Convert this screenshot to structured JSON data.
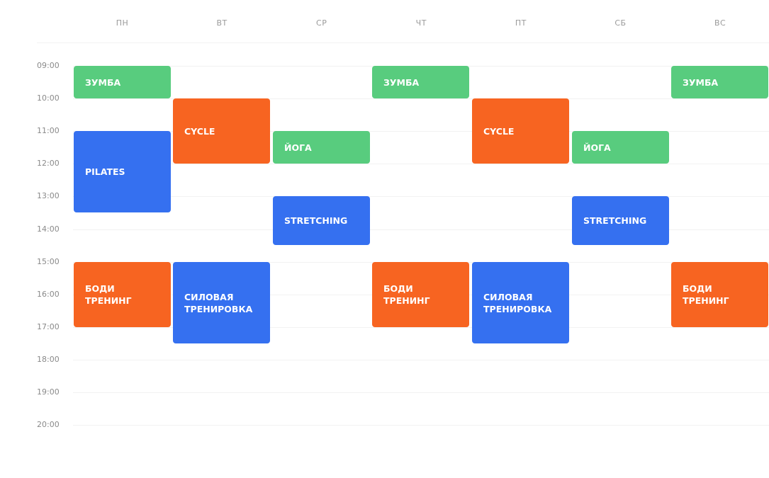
{
  "schedule": {
    "days": [
      "ПН",
      "ВТ",
      "СР",
      "ЧТ",
      "ПТ",
      "СБ",
      "ВС"
    ],
    "hours": [
      "09:00",
      "10:00",
      "11:00",
      "12:00",
      "13:00",
      "14:00",
      "15:00",
      "16:00",
      "17:00",
      "18:00",
      "19:00",
      "20:00"
    ],
    "colors": {
      "green": "#58cc7e",
      "orange": "#f76421",
      "blue": "#3570f0"
    },
    "events": [
      {
        "day": 0,
        "title": "ЗУМБА",
        "start": 9,
        "end": 10,
        "color": "green"
      },
      {
        "day": 0,
        "title": "PILATES",
        "start": 11,
        "end": 13.5,
        "color": "blue"
      },
      {
        "day": 0,
        "title": "БОДИ ТРЕНИНГ",
        "start": 15,
        "end": 17,
        "color": "orange"
      },
      {
        "day": 1,
        "title": "CYCLE",
        "start": 10,
        "end": 12,
        "color": "orange"
      },
      {
        "day": 1,
        "title": "СИЛОВАЯ ТРЕНИРОВКА",
        "start": 15,
        "end": 17.5,
        "color": "blue"
      },
      {
        "day": 2,
        "title": "ЙОГА",
        "start": 11,
        "end": 12,
        "color": "green"
      },
      {
        "day": 2,
        "title": "STRETCHING",
        "start": 13,
        "end": 14.5,
        "color": "blue"
      },
      {
        "day": 3,
        "title": "ЗУМБА",
        "start": 9,
        "end": 10,
        "color": "green"
      },
      {
        "day": 3,
        "title": "БОДИ ТРЕНИНГ",
        "start": 15,
        "end": 17,
        "color": "orange"
      },
      {
        "day": 4,
        "title": "CYCLE",
        "start": 10,
        "end": 12,
        "color": "orange"
      },
      {
        "day": 4,
        "title": "СИЛОВАЯ ТРЕНИРОВКА",
        "start": 15,
        "end": 17.5,
        "color": "blue"
      },
      {
        "day": 5,
        "title": "ЙОГА",
        "start": 11,
        "end": 12,
        "color": "green"
      },
      {
        "day": 5,
        "title": "STRETCHING",
        "start": 13,
        "end": 14.5,
        "color": "blue"
      },
      {
        "day": 6,
        "title": "ЗУМБА",
        "start": 9,
        "end": 10,
        "color": "green"
      },
      {
        "day": 6,
        "title": "БОДИ ТРЕНИНГ",
        "start": 15,
        "end": 17,
        "color": "orange"
      }
    ]
  }
}
